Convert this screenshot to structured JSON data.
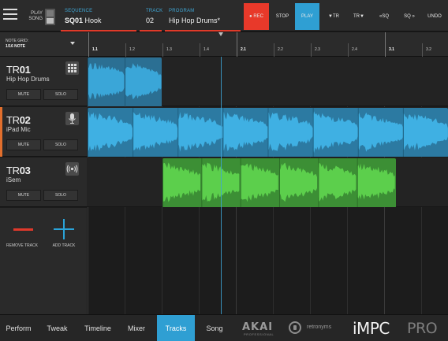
{
  "topbar": {
    "play_song_top": "PLAY",
    "play_song_bottom": "SONG",
    "sequence_caption": "SEQUENCE",
    "sequence_name_prefix": "SQ01",
    "sequence_name": "Hook",
    "track_caption": "TRACK",
    "track_number": "02",
    "program_caption": "PROGRAM",
    "program_name": "Hip Hop Drums*",
    "rec_label": "REC",
    "stop_label": "STOP",
    "play_label": "PLAY",
    "track_down_label": "TR",
    "track_up_label": "TR",
    "seq_down_label": "SQ",
    "seq_up_label": "SQ",
    "undo_label": "UNDO"
  },
  "note_grid": {
    "label": "NOTE GRID:",
    "value": "1/16 NOTE"
  },
  "ruler": {
    "labels": [
      "1.1",
      "1.2",
      "1.3",
      "1.4",
      "2.1",
      "2.2",
      "2.3",
      "2.4",
      "3.1",
      "3.2"
    ]
  },
  "tracks": [
    {
      "prefix": "TR",
      "number": "01",
      "program": "Hip Hop Drums",
      "icon": "drum-pad-grid-icon",
      "mute": "MUTE",
      "solo": "SOLO"
    },
    {
      "prefix": "TR",
      "number": "02",
      "program": "iPad Mic",
      "icon": "microphone-icon",
      "mute": "MUTE",
      "solo": "SOLO"
    },
    {
      "prefix": "TR",
      "number": "03",
      "program": "iSem",
      "icon": "broadcast-icon",
      "mute": "MUTE",
      "solo": "SOLO"
    }
  ],
  "track_actions": {
    "remove": "REMOVE TRACK",
    "add": "ADD TRACK"
  },
  "colors": {
    "accent_blue": "#2f9fd3",
    "record_red": "#e8392a",
    "selected_orange": "#e26f2d",
    "audio_clip_blue": "#3aa0cf",
    "synth_clip_green": "#57c24a"
  },
  "bottom_tabs": [
    "Perform",
    "Tweak",
    "Timeline",
    "Mixer",
    "Tracks",
    "Song"
  ],
  "active_tab": "Tracks",
  "branding": {
    "akai": "AKAI",
    "akai_sub": "PROFESSIONAL",
    "retronyms": "retronyms",
    "impc": "iMPC",
    "pro": "PRO"
  }
}
